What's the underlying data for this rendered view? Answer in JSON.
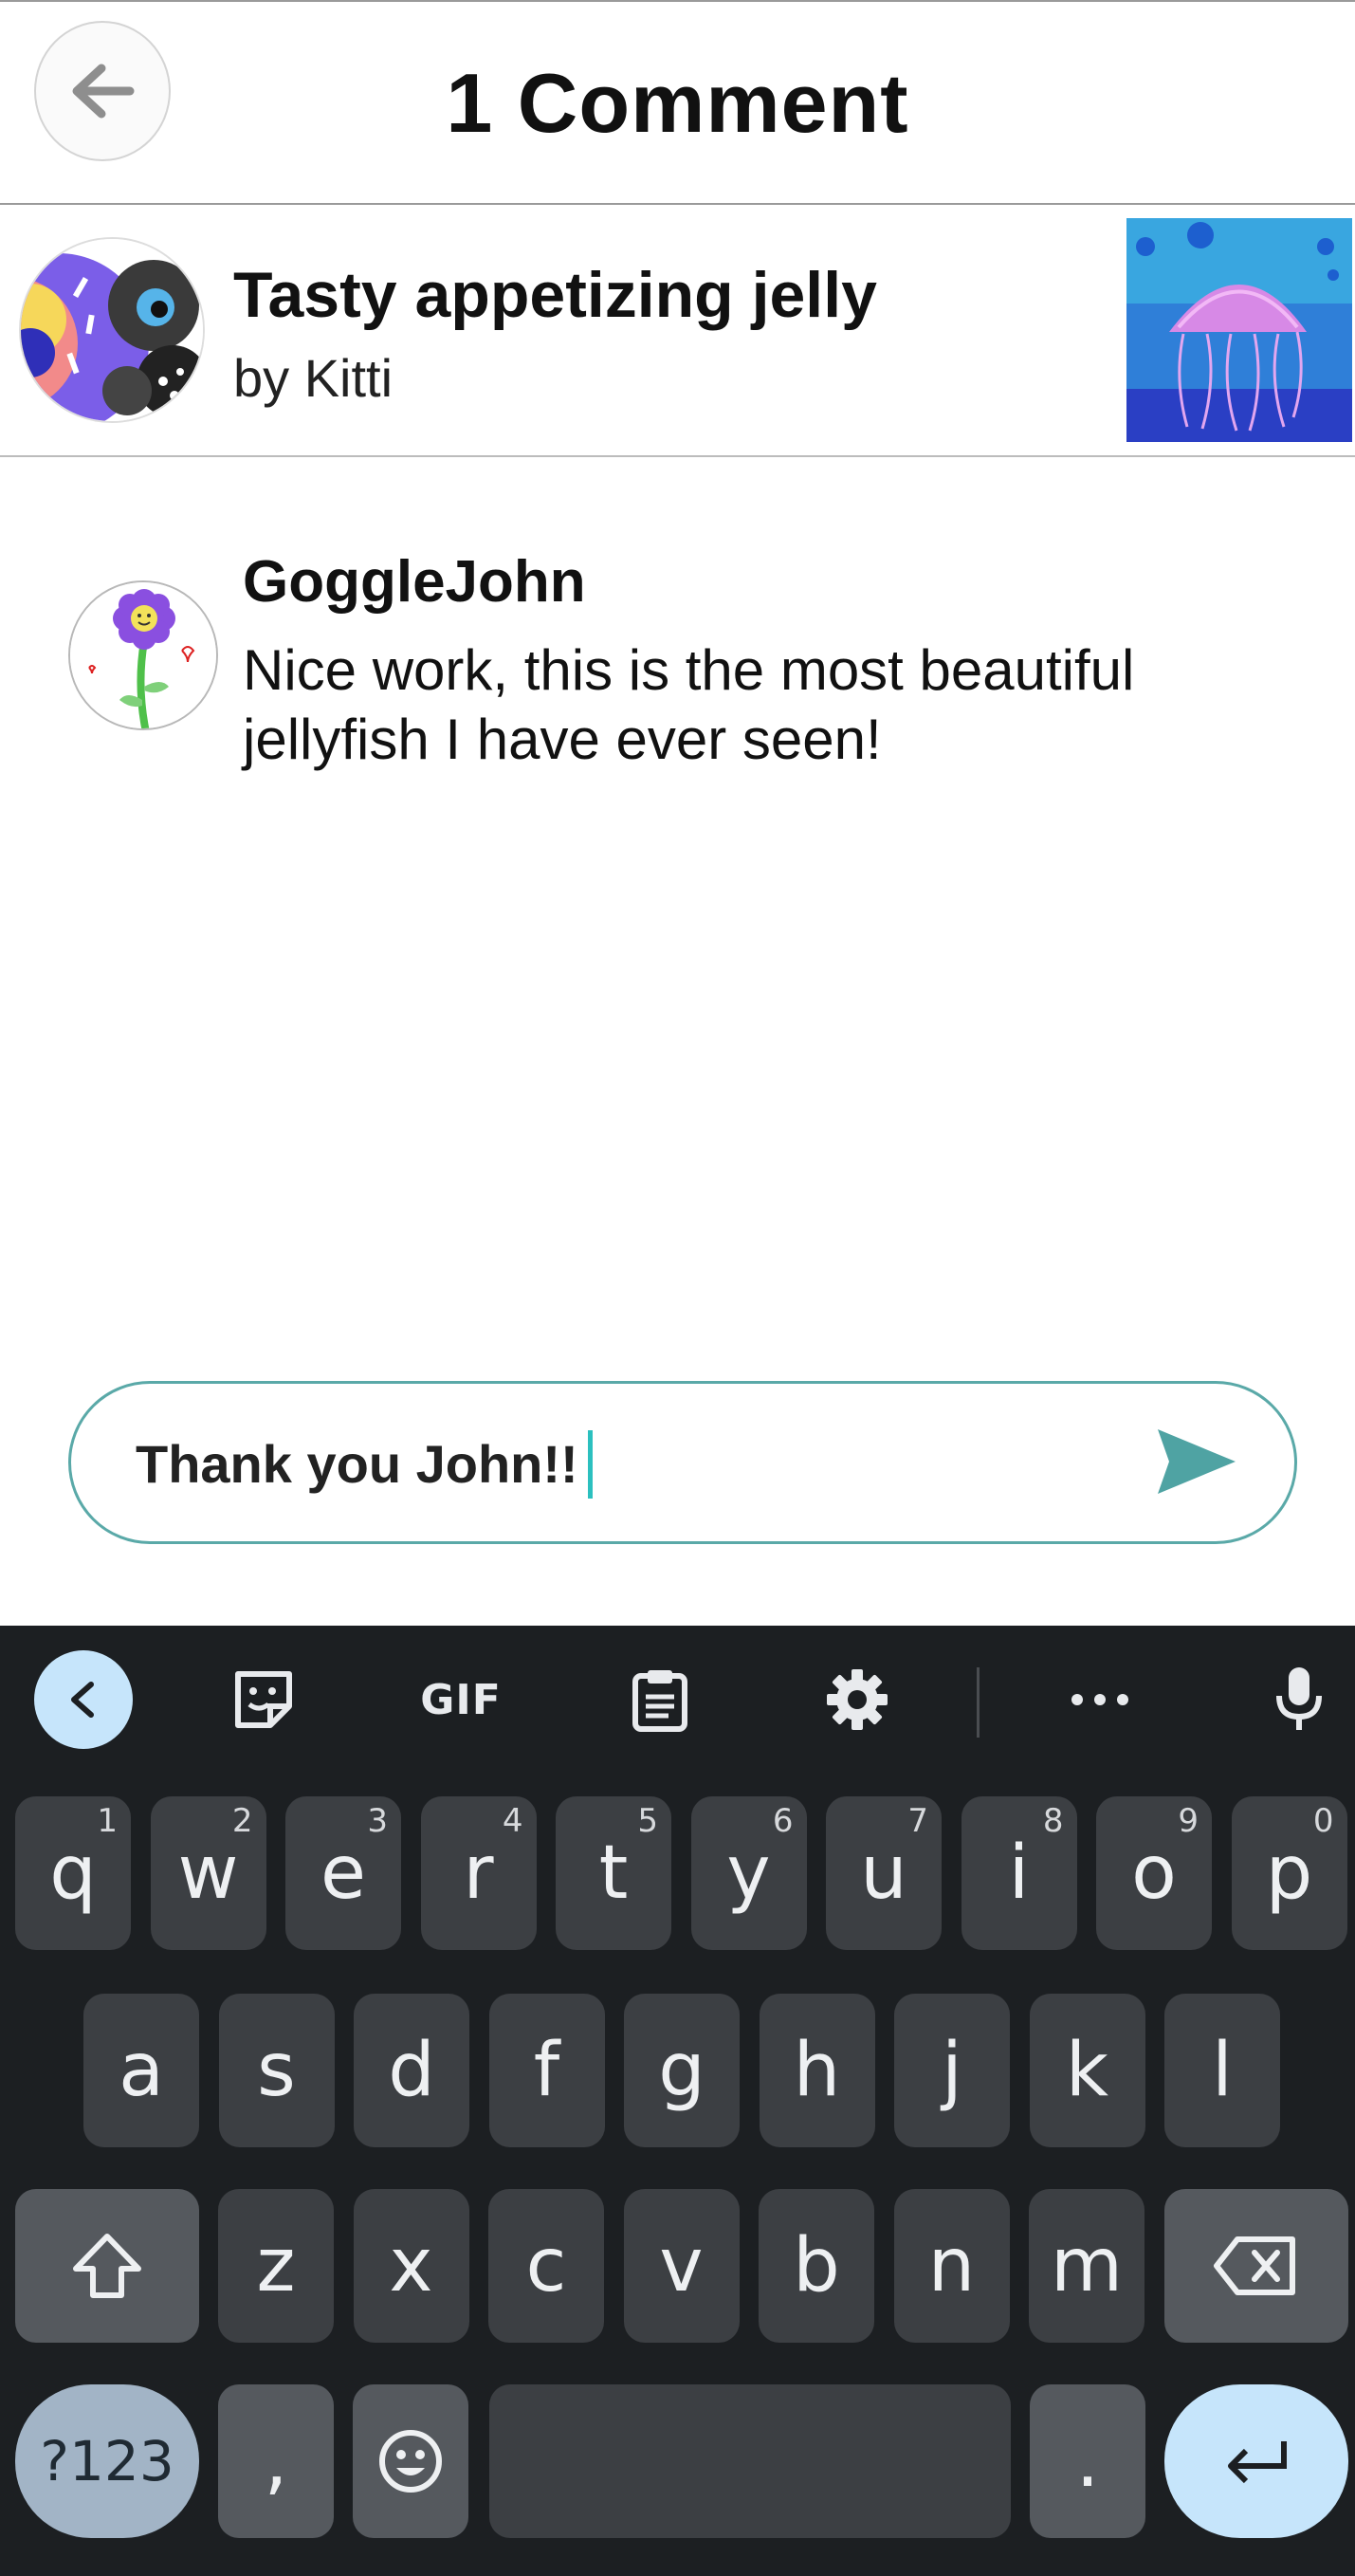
{
  "header": {
    "title": "1 Comment"
  },
  "artwork": {
    "title": "Tasty appetizing jelly",
    "author_line": "by Kitti"
  },
  "comment": {
    "username": "GoggleJohn",
    "text": "Nice work, this is the most beautiful jellyfish I have ever seen!"
  },
  "input": {
    "value": "Thank you John!!"
  },
  "keyboard": {
    "toolbar": {
      "gif_label": "GIF"
    },
    "row1": [
      {
        "key": "q",
        "sup": "1"
      },
      {
        "key": "w",
        "sup": "2"
      },
      {
        "key": "e",
        "sup": "3"
      },
      {
        "key": "r",
        "sup": "4"
      },
      {
        "key": "t",
        "sup": "5"
      },
      {
        "key": "y",
        "sup": "6"
      },
      {
        "key": "u",
        "sup": "7"
      },
      {
        "key": "i",
        "sup": "8"
      },
      {
        "key": "o",
        "sup": "9"
      },
      {
        "key": "p",
        "sup": "0"
      }
    ],
    "row2": [
      "a",
      "s",
      "d",
      "f",
      "g",
      "h",
      "j",
      "k",
      "l"
    ],
    "row3": [
      "z",
      "x",
      "c",
      "v",
      "b",
      "n",
      "m"
    ],
    "symbols_label": "?123",
    "comma": ",",
    "period": "."
  },
  "colors": {
    "accent": "#5aa9a8",
    "send": "#4fa3a3",
    "keyboard_bg": "#1c1f22",
    "key_bg": "#3c3f43",
    "enter_bg": "#c6e5fb"
  }
}
